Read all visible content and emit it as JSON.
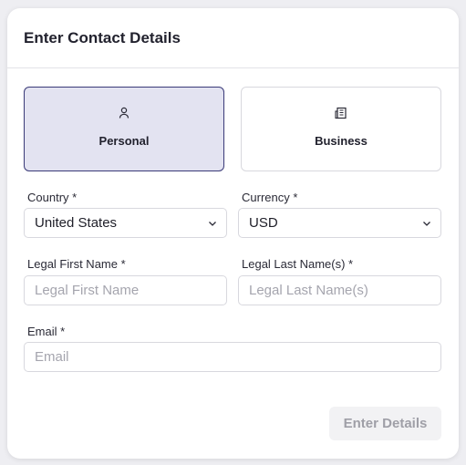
{
  "header": {
    "title": "Enter Contact Details"
  },
  "type_selector": {
    "options": [
      {
        "label": "Personal",
        "icon": "person-icon",
        "selected": true
      },
      {
        "label": "Business",
        "icon": "building-icon",
        "selected": false
      }
    ]
  },
  "form": {
    "country": {
      "label": "Country *",
      "value": "United States"
    },
    "currency": {
      "label": "Currency *",
      "value": "USD"
    },
    "first_name": {
      "label": "Legal First Name *",
      "placeholder": "Legal First Name"
    },
    "last_name": {
      "label": "Legal Last Name(s) *",
      "placeholder": "Legal Last Name(s)"
    },
    "email": {
      "label": "Email *",
      "placeholder": "Email"
    }
  },
  "actions": {
    "submit_label": "Enter Details",
    "submit_disabled": true
  },
  "colors": {
    "selected_bg": "#e3e3f1",
    "selected_border": "#3a3a78",
    "disabled_text": "#9f9fa7"
  }
}
